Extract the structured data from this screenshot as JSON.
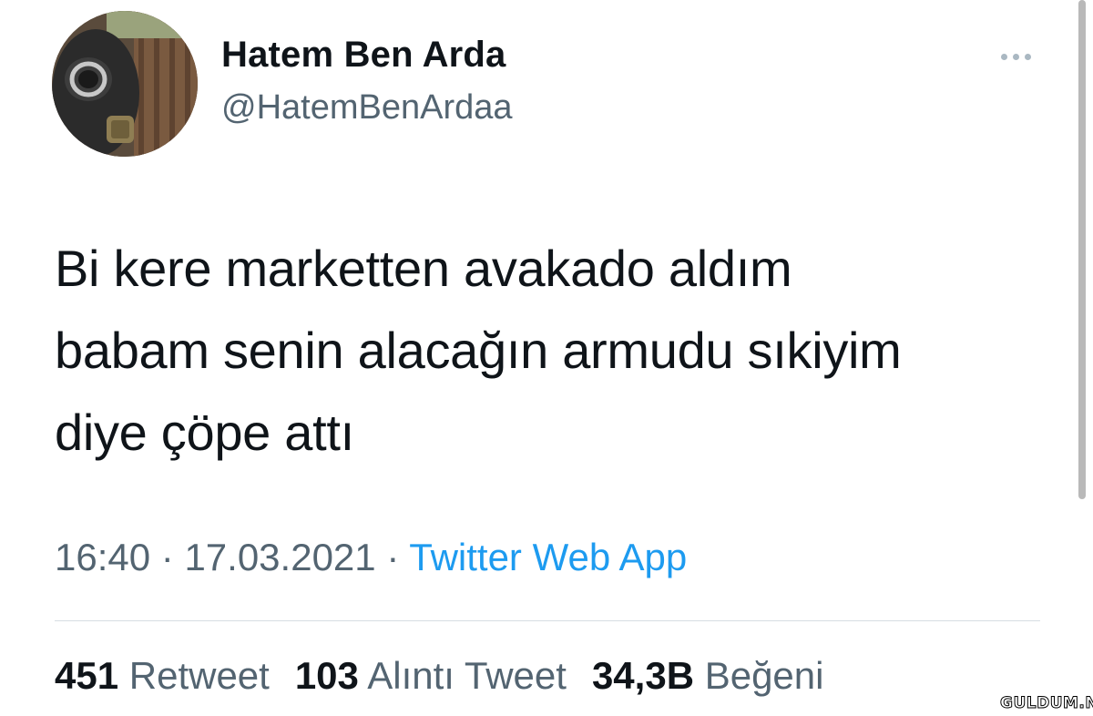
{
  "user": {
    "display_name": "Hatem Ben Arda",
    "handle": "@HatemBenArdaa"
  },
  "tweet": {
    "lines": [
      "Bi kere marketten avakado aldım",
      "babam senin alacağın armudu sıkiyim",
      "diye çöpe attı"
    ],
    "time": "16:40",
    "separator": " · ",
    "date": "17.03.2021",
    "source": "Twitter Web App"
  },
  "stats": {
    "retweets": {
      "count": "451",
      "label": "Retweet"
    },
    "quotes": {
      "count": "103",
      "label": "Alıntı Tweet"
    },
    "likes": {
      "count": "34,3B",
      "label": "Beğeni"
    }
  },
  "icons": {
    "more": "more-horizontal-icon"
  },
  "colors": {
    "text": "#0f1419",
    "secondary": "#536471",
    "link": "#1d9bf0",
    "divider": "#d6dde2"
  },
  "watermark": "GULDUM.NET"
}
